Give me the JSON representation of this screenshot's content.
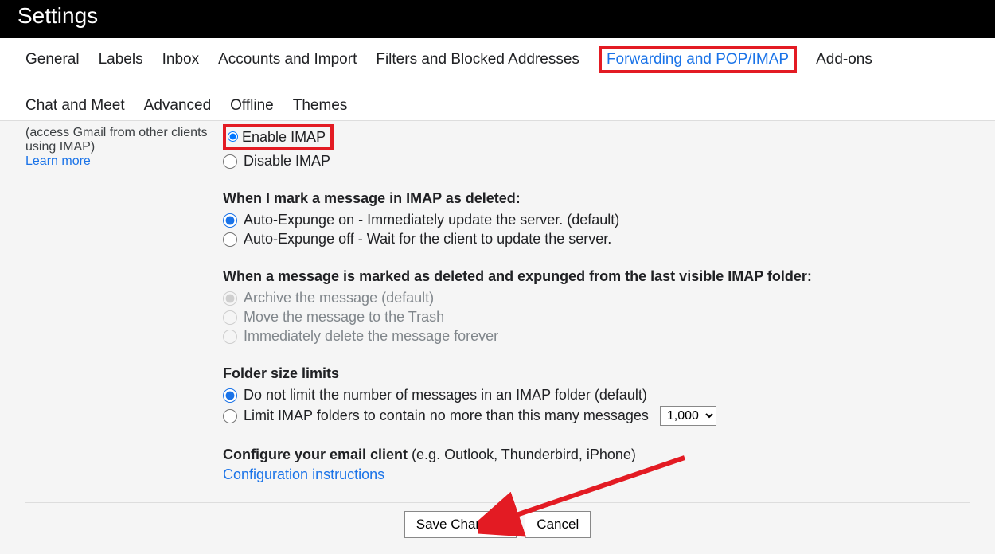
{
  "header": {
    "title": "Settings"
  },
  "tabs": [
    {
      "label": "General"
    },
    {
      "label": "Labels"
    },
    {
      "label": "Inbox"
    },
    {
      "label": "Accounts and Import"
    },
    {
      "label": "Filters and Blocked Addresses"
    },
    {
      "label": "Forwarding and POP/IMAP",
      "active": true,
      "highlighted": true
    },
    {
      "label": "Add-ons"
    },
    {
      "label": "Chat and Meet"
    },
    {
      "label": "Advanced"
    },
    {
      "label": "Offline"
    },
    {
      "label": "Themes"
    }
  ],
  "left": {
    "line1": "(access Gmail from other clients",
    "line2": "using IMAP)",
    "learn_more": "Learn more"
  },
  "imap_status": {
    "enable": "Enable IMAP",
    "disable": "Disable IMAP"
  },
  "expunge": {
    "title": "When I mark a message in IMAP as deleted:",
    "opt_on": "Auto-Expunge on - Immediately update the server. (default)",
    "opt_off": "Auto-Expunge off - Wait for the client to update the server."
  },
  "deleted_folder": {
    "title": "When a message is marked as deleted and expunged from the last visible IMAP folder:",
    "opt_archive": "Archive the message (default)",
    "opt_trash": "Move the message to the Trash",
    "opt_delete": "Immediately delete the message forever"
  },
  "folder_limits": {
    "title": "Folder size limits",
    "opt_nolimit": "Do not limit the number of messages in an IMAP folder (default)",
    "opt_limit": "Limit IMAP folders to contain no more than this many messages",
    "select_value": "1,000"
  },
  "configure": {
    "bold": "Configure your email client",
    "rest": " (e.g. Outlook, Thunderbird, iPhone)",
    "link": "Configuration instructions"
  },
  "buttons": {
    "save": "Save Changes",
    "cancel": "Cancel"
  }
}
